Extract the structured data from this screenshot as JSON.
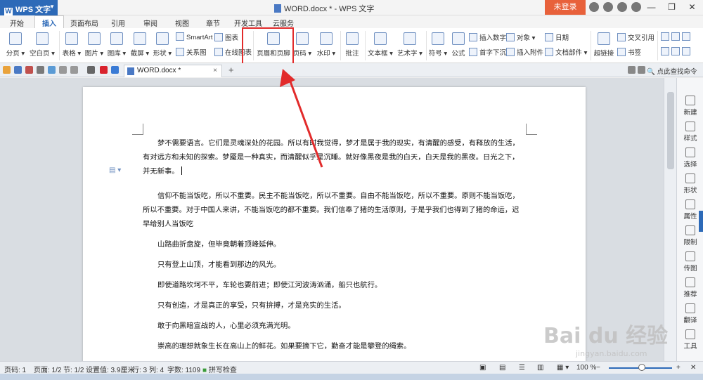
{
  "app": {
    "name": "WPS 文字",
    "window_title": "WORD.docx * - WPS 文字",
    "login_label": "未登录",
    "minimize": "—",
    "restore": "❐",
    "close": "✕"
  },
  "menu_tabs": [
    "开始",
    "插入",
    "页面布局",
    "引用",
    "审阅",
    "视图",
    "章节",
    "开发工具",
    "云服务"
  ],
  "active_tab": "插入",
  "ribbon": {
    "page_break": "分页",
    "blank_page": "空白页",
    "table": "表格",
    "picture": "图片",
    "gallery": "图库",
    "screenshot": "截屏",
    "shapes": "形状",
    "smartart": "SmartArt",
    "chart": "图表",
    "relation_chart": "关系图",
    "online_chart": "在线图表",
    "header_footer": "页眉和页脚",
    "page_number": "页码",
    "watermark": "水印",
    "comment": "批注",
    "textbox": "文本框",
    "wordart": "艺术字",
    "symbol": "符号",
    "formula": "公式",
    "insert_number": "插入数字",
    "dropcap": "首字下沉",
    "object": "对象",
    "attachment": "插入附件",
    "date": "日期",
    "doc_parts": "文档部件",
    "hyperlink": "超链接",
    "cross_ref": "交叉引用",
    "bookmark": "书签"
  },
  "doc_tab": {
    "name": "WORD.docx *",
    "close": "×",
    "add": "+",
    "command_search": "点此查找命令"
  },
  "document": {
    "paragraphs": [
      "梦不需要语言。它们是灵魂深处的花园。所以有时我觉得，梦才是属于我的现实，有清醒的感受，有释放的生活，有对远方和未知的探索。梦魇是一种真实，而清醒似乎是沉睡。就好像黑夜是我的白天，白天是我的黑夜。日光之下，并无新事。",
      "信仰不能当饭吃，所以不重要。民主不能当饭吃，所以不重要。自由不能当饭吃，所以不重要。原则不能当饭吃，所以不重要。对于中国人来讲，不能当饭吃的都不重要。我们信奉了猪的生活原则，于是乎我们也得到了猪的命运，迟早给别人当饭吃",
      "山路曲折盘旋，但毕竟朝着顶峰延伸。",
      "只有登上山顶，才能看到那边的风光。",
      "即使道路坎坷不平，车轮也要前进；即使江河波涛汹涌，船只也航行。",
      "只有创造，才是真正的享受，只有拚搏，才是充实的生活。",
      "敢于向黑暗宣战的人，心里必须充满光明。",
      "崇高的理想就象生长在高山上的鲜花。如果要摘下它，勤奋才能是攀登的绳索。"
    ]
  },
  "right_panel": [
    "新建",
    "样式",
    "选择",
    "形状",
    "属性",
    "限制",
    "传图",
    "推荐",
    "翻译",
    "工具"
  ],
  "status": {
    "page_no": "页码: 1",
    "pages": "页面: 1/2",
    "section": "节: 1/2",
    "setting": "设置值: 3.9厘米",
    "line": "行: 3",
    "col": "列: 4",
    "words": "字数: 1109",
    "spellcheck": "拼写检查",
    "zoom": "100 %",
    "zoom_minus": "−",
    "zoom_plus": "+"
  },
  "watermark": {
    "logo": "Bai du 经验",
    "url": "jingyan.baidu.com"
  },
  "colors": {
    "brand_blue": "#2d6ab8",
    "login_orange": "#e8613b",
    "highlight_red": "#e22b2b"
  }
}
